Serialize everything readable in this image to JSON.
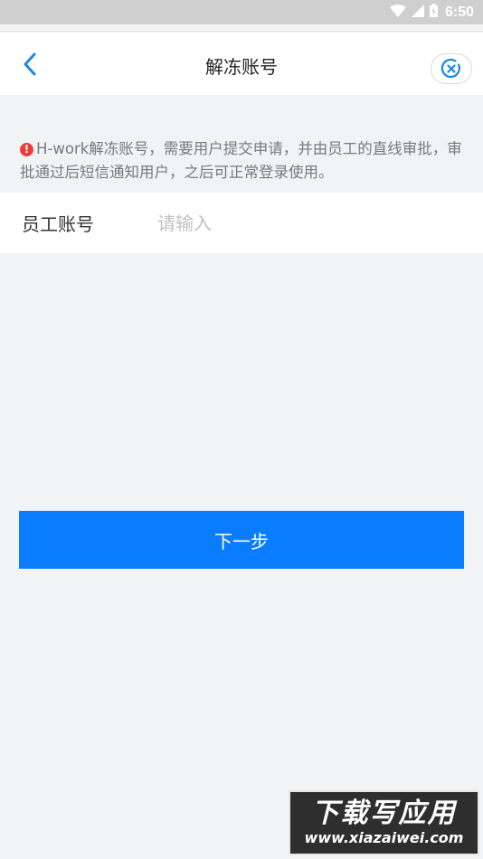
{
  "status_bar": {
    "time": "6:50"
  },
  "nav": {
    "title": "解冻账号"
  },
  "notice": {
    "text": "H-work解冻账号，需要用户提交申请，并由员工的直线审批，审批通过后短信通知用户，之后可正常登录使用。"
  },
  "form": {
    "account_label": "员工账号",
    "account_placeholder": "请输入"
  },
  "actions": {
    "next_label": "下一步"
  },
  "watermark": {
    "title": "下载写应用",
    "url": "www.xiazaiwei.com"
  },
  "colors": {
    "primary": "#0a7cff",
    "warning": "#f03a3a",
    "background": "#f2f3f5"
  }
}
